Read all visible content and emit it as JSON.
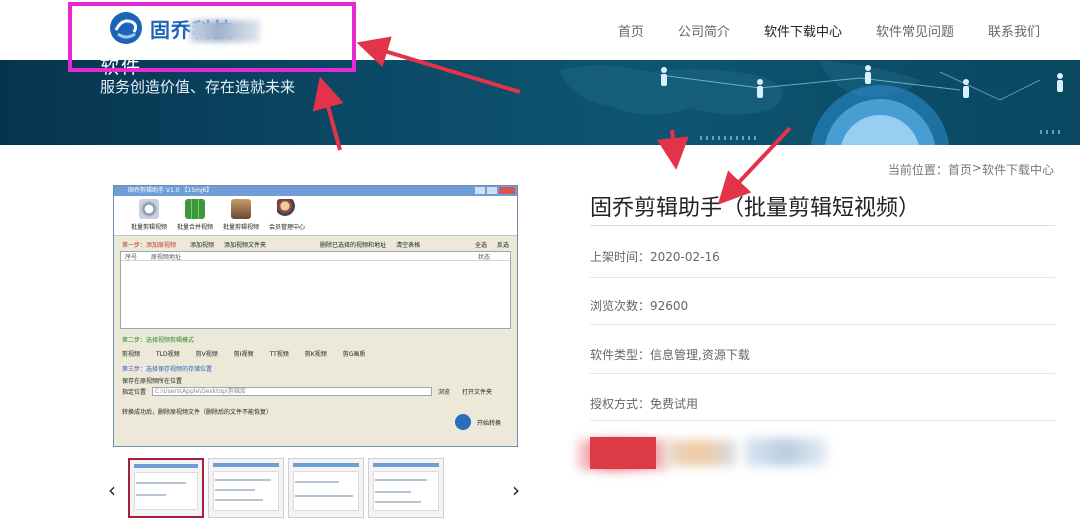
{
  "header": {
    "logo_text": "固乔科技",
    "nav": [
      "首页",
      "公司简介",
      "软件下载中心",
      "软件常见问题",
      "联系我们"
    ],
    "active_nav": "软件下载中心"
  },
  "banner": {
    "title": "软件",
    "subtitle": "服务创造价值、存在造就未来"
  },
  "breadcrumb": {
    "prefix": "当前位置：",
    "home": "首页",
    "separator": ">",
    "current": "软件下载中心"
  },
  "product": {
    "title": "固乔剪辑助手（批量剪辑短视频）",
    "fields": [
      {
        "label": "上架时间：",
        "value": "2020-02-16"
      },
      {
        "label": "浏览次数：",
        "value": "92600"
      },
      {
        "label": "软件类型：",
        "value": "信息管理,资源下载"
      },
      {
        "label": "授权方式：",
        "value": "免费试用"
      }
    ]
  },
  "preview": {
    "window_title": "固乔剪辑助手 V1.0  【15mj6】",
    "tools": [
      "批量剪辑视频",
      "批量合并视频",
      "批量剪辑视频",
      "会员管理中心"
    ],
    "step1": "第一步：添加原视频",
    "step1_buttons": [
      "添加视频",
      "添加视频文件夹",
      "删除已选择的视频和地址",
      "清空表格"
    ],
    "step1_checks": [
      "全选",
      "反选"
    ],
    "list_headers": [
      "序号",
      "原视频地址",
      "状态"
    ],
    "step2": "第二步：选择视频剪辑模式",
    "modes": [
      "剪视频",
      "TLD视频",
      "剪V视频",
      "剪I视频",
      "TT视频",
      "剪K视频",
      "剪G画质"
    ],
    "step3": "第三步：选择保存视频的存储位置",
    "save_option1": "保存在原视频所在位置",
    "save_option2": "指定位置",
    "save_path": "C:\\Users\\Apple\\Desktop\\剪辑库",
    "browse": "浏览",
    "open_folder": "打开文件夹",
    "delete_after": "转换成功后，删除原视频文件（删除后的文件不能恢复）",
    "start": "开始转换"
  },
  "colors": {
    "annotation": "#e629d3",
    "arrow": "#e2334a",
    "brand": "#1b64b8",
    "download": "#dc3b46"
  }
}
